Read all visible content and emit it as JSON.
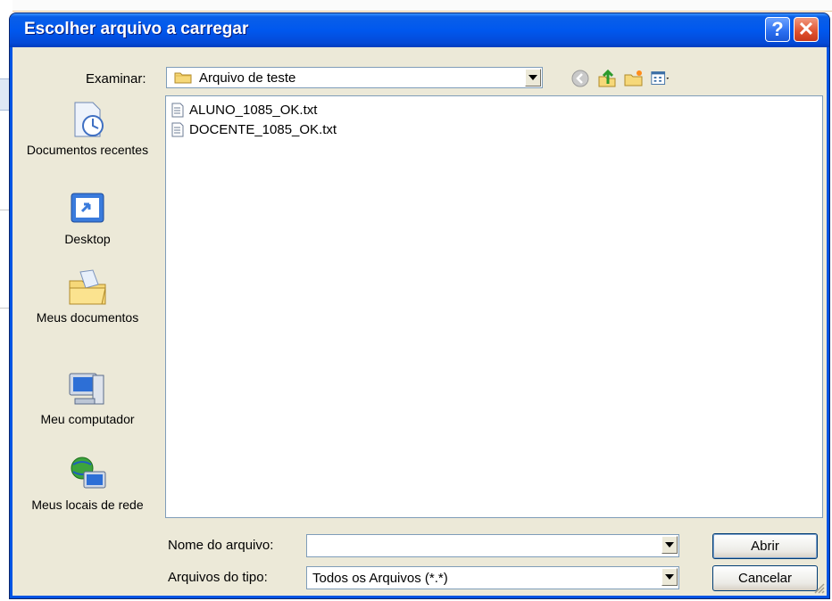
{
  "dialog": {
    "title": "Escolher arquivo a carregar",
    "help_button": "?",
    "close_button": "✕"
  },
  "toolbar": {
    "lookin_label": "Examinar:",
    "lookin_value": "Arquivo de teste"
  },
  "places": [
    {
      "label": "Documentos recentes",
      "icon": "recent-documents-icon"
    },
    {
      "label": "Desktop",
      "icon": "desktop-icon"
    },
    {
      "label": "Meus documentos",
      "icon": "my-documents-icon"
    },
    {
      "label": "Meu computador",
      "icon": "my-computer-icon"
    },
    {
      "label": "Meus locais de rede",
      "icon": "network-places-icon"
    }
  ],
  "files": [
    {
      "name": "ALUNO_1085_OK.txt",
      "icon": "text-file-icon"
    },
    {
      "name": "DOCENTE_1085_OK.txt",
      "icon": "text-file-icon"
    }
  ],
  "filename": {
    "label": "Nome do arquivo:",
    "value": ""
  },
  "filetype": {
    "label": "Arquivos do tipo:",
    "value": "Todos os Arquivos (*.*)"
  },
  "buttons": {
    "open": "Abrir",
    "cancel": "Cancelar"
  },
  "colors": {
    "titlebar": "#0058ee",
    "dialog_bg": "#ece9d8",
    "close_button": "#e0512e"
  }
}
